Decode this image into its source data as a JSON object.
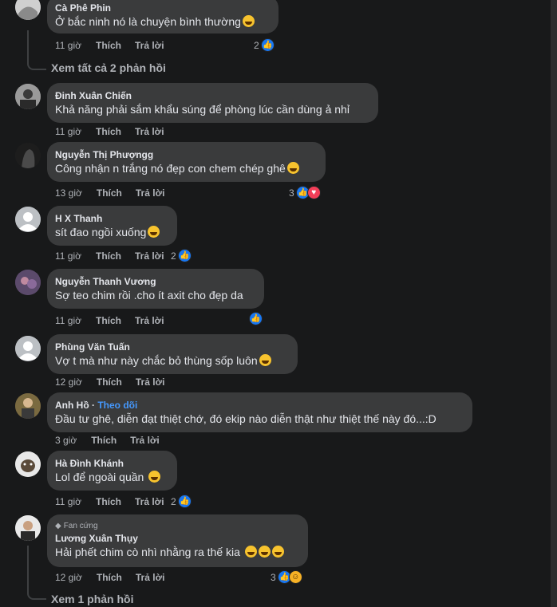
{
  "comments": [
    {
      "name": "Cà Phê Phin",
      "text": "Ở bắc ninh nó là chuyện bình thường",
      "time": "11 giờ",
      "like": "Thích",
      "reply": "Trả lời",
      "react_count": "2"
    },
    {
      "name": "Đinh Xuân Chiến",
      "text": "Khả năng phải sắm khẩu súng để phòng lúc cần dùng ả nhỉ",
      "time": "11 giờ",
      "like": "Thích",
      "reply": "Trả lời"
    },
    {
      "name": "Nguyễn Thị Phượngg",
      "text": "Công nhận n trắng nó đẹp con chem chép ghê",
      "time": "13 giờ",
      "like": "Thích",
      "reply": "Trả lời",
      "react_count": "3"
    },
    {
      "name": "H X Thanh",
      "text": "sít đao ngồi xuống",
      "time": "11 giờ",
      "like": "Thích",
      "reply": "Trả lời",
      "react_count": "2"
    },
    {
      "name": "Nguyễn Thanh Vương",
      "text": "Sợ teo chim rồi .cho ít axit cho đẹp da",
      "time": "11 giờ",
      "like": "Thích",
      "reply": "Trả lời"
    },
    {
      "name": "Phùng Văn Tuấn",
      "text": "Vợ t mà như này chắc bỏ thùng sốp luôn",
      "time": "12 giờ",
      "like": "Thích",
      "reply": "Trả lời"
    },
    {
      "name": "Anh Hồ",
      "follow": "Theo dõi",
      "text": "Đầu tư ghê, diễn đạt thiệt chớ, đó ekip nào diễn thật như thiệt thế này đó...:D",
      "time": "3 giờ",
      "like": "Thích",
      "reply": "Trả lời"
    },
    {
      "name": "Hà Đình Khánh",
      "text": "Lol để ngoài quần",
      "time": "11 giờ",
      "like": "Thích",
      "reply": "Trả lời",
      "react_count": "2"
    },
    {
      "badge": "Fan cứng",
      "name": "Lương Xuân Thụy",
      "text": "Hải phết chim cò nhì nhằng ra thế kia",
      "time": "12 giờ",
      "like": "Thích",
      "reply": "Trả lời",
      "react_count": "3"
    }
  ],
  "view_replies_1": "Xem tất cả 2 phản hồi",
  "view_replies_2": "Xem 1 phản hồi",
  "colors": {
    "background": "#18191a",
    "bubble": "#3a3b3c",
    "link": "#4599ff",
    "like": "#1877f2",
    "heart": "#f33e58"
  }
}
